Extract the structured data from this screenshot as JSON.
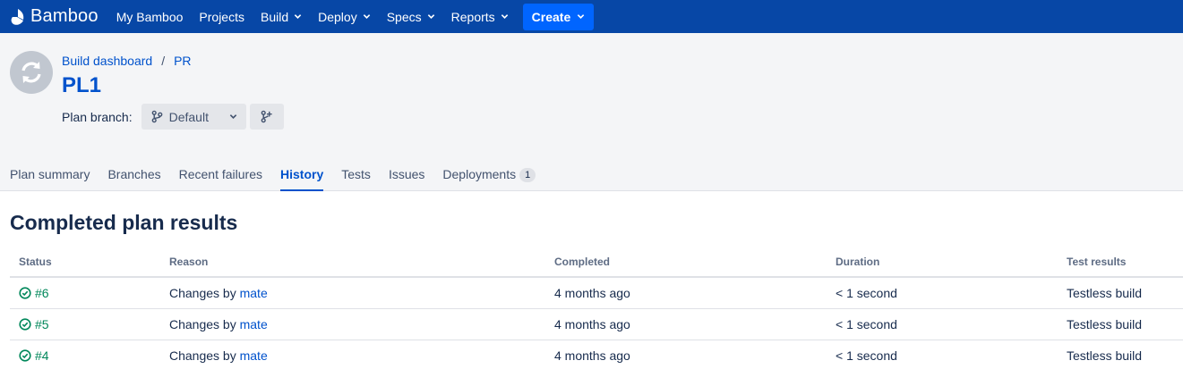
{
  "nav": {
    "logo_text": "Bamboo",
    "items": [
      {
        "label": "My Bamboo",
        "has_dropdown": false
      },
      {
        "label": "Projects",
        "has_dropdown": false
      },
      {
        "label": "Build",
        "has_dropdown": true
      },
      {
        "label": "Deploy",
        "has_dropdown": true
      },
      {
        "label": "Specs",
        "has_dropdown": true
      },
      {
        "label": "Reports",
        "has_dropdown": true
      }
    ],
    "create_label": "Create",
    "colors": {
      "nav_bg": "#0747a6",
      "create_bg": "#0065ff"
    }
  },
  "header": {
    "breadcrumb": [
      "Build dashboard",
      "PR"
    ],
    "breadcrumb_separator": "/",
    "title": "PL1",
    "branch_label": "Plan branch:",
    "branch_value": "Default"
  },
  "tabs": [
    {
      "label": "Plan summary",
      "active": false
    },
    {
      "label": "Branches",
      "active": false
    },
    {
      "label": "Recent failures",
      "active": false
    },
    {
      "label": "History",
      "active": true
    },
    {
      "label": "Tests",
      "active": false
    },
    {
      "label": "Issues",
      "active": false
    },
    {
      "label": "Deployments",
      "active": false,
      "badge": "1"
    }
  ],
  "results": {
    "title": "Completed plan results",
    "columns": [
      "Status",
      "Reason",
      "Completed",
      "Duration",
      "Test results"
    ],
    "rows": [
      {
        "status": "success",
        "build": "#6",
        "reason_prefix": "Changes by",
        "reason_user": "mate",
        "completed": "4 months ago",
        "duration": "< 1 second",
        "tests": "Testless build"
      },
      {
        "status": "success",
        "build": "#5",
        "reason_prefix": "Changes by",
        "reason_user": "mate",
        "completed": "4 months ago",
        "duration": "< 1 second",
        "tests": "Testless build"
      },
      {
        "status": "success",
        "build": "#4",
        "reason_prefix": "Changes by",
        "reason_user": "mate",
        "completed": "4 months ago",
        "duration": "< 1 second",
        "tests": "Testless build"
      }
    ],
    "colors": {
      "success": "#00875a",
      "link": "#0052cc"
    }
  }
}
